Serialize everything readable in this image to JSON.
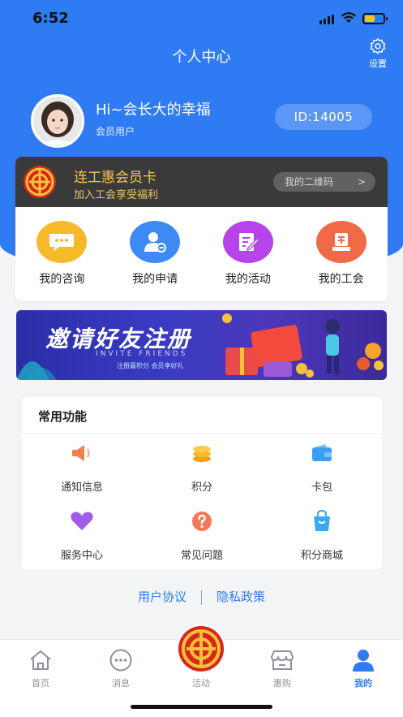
{
  "status_bar": {
    "time": "6:52"
  },
  "header": {
    "title": "个人中心",
    "settings_label": "设置"
  },
  "profile": {
    "greeting": "Hi~会长大的幸福",
    "role": "会员用户",
    "id_label": "ID:14005"
  },
  "member_card": {
    "title": "连工惠会员卡",
    "subtitle": "加入工会享受福利",
    "qr_button": "我的二维码",
    "qr_arrow": ">"
  },
  "quick_actions": [
    {
      "label": "我的咨询",
      "icon": "chat-bubble-icon",
      "color": "#f5b92a"
    },
    {
      "label": "我的申请",
      "icon": "user-apply-icon",
      "color": "#3d8af5"
    },
    {
      "label": "我的活动",
      "icon": "edit-note-icon",
      "color": "#b644e8"
    },
    {
      "label": "我的工会",
      "icon": "union-book-icon",
      "color": "#f06a48"
    }
  ],
  "banner": {
    "title": "邀请好友注册",
    "subtitle": "INVITE FRIENDS",
    "note": "注册赢积分 会员享好礼"
  },
  "common_functions": {
    "title": "常用功能",
    "items": [
      {
        "label": "通知信息",
        "icon": "megaphone-icon",
        "color": "#f08050"
      },
      {
        "label": "积分",
        "icon": "coins-icon",
        "color": "#f5b92a"
      },
      {
        "label": "卡包",
        "icon": "wallet-icon",
        "color": "#3a9ef5"
      },
      {
        "label": "服务中心",
        "icon": "heart-icon",
        "color": "#a05be8"
      },
      {
        "label": "常见问题",
        "icon": "question-icon",
        "color": "#f5785a"
      },
      {
        "label": "积分商城",
        "icon": "shopping-bag-icon",
        "color": "#3aa8f5"
      }
    ]
  },
  "footer_links": {
    "agreement": "用户协议",
    "privacy": "隐私政策"
  },
  "tab_bar": [
    {
      "label": "首页",
      "icon": "home-icon"
    },
    {
      "label": "消息",
      "icon": "message-icon"
    },
    {
      "label": "活动",
      "icon": "union-logo-icon"
    },
    {
      "label": "惠购",
      "icon": "store-icon"
    },
    {
      "label": "我的",
      "icon": "profile-icon",
      "active": true
    }
  ],
  "colors": {
    "primary": "#2f7bf3",
    "card_dark": "#3a3a3a",
    "gold": "#f2c94c"
  }
}
